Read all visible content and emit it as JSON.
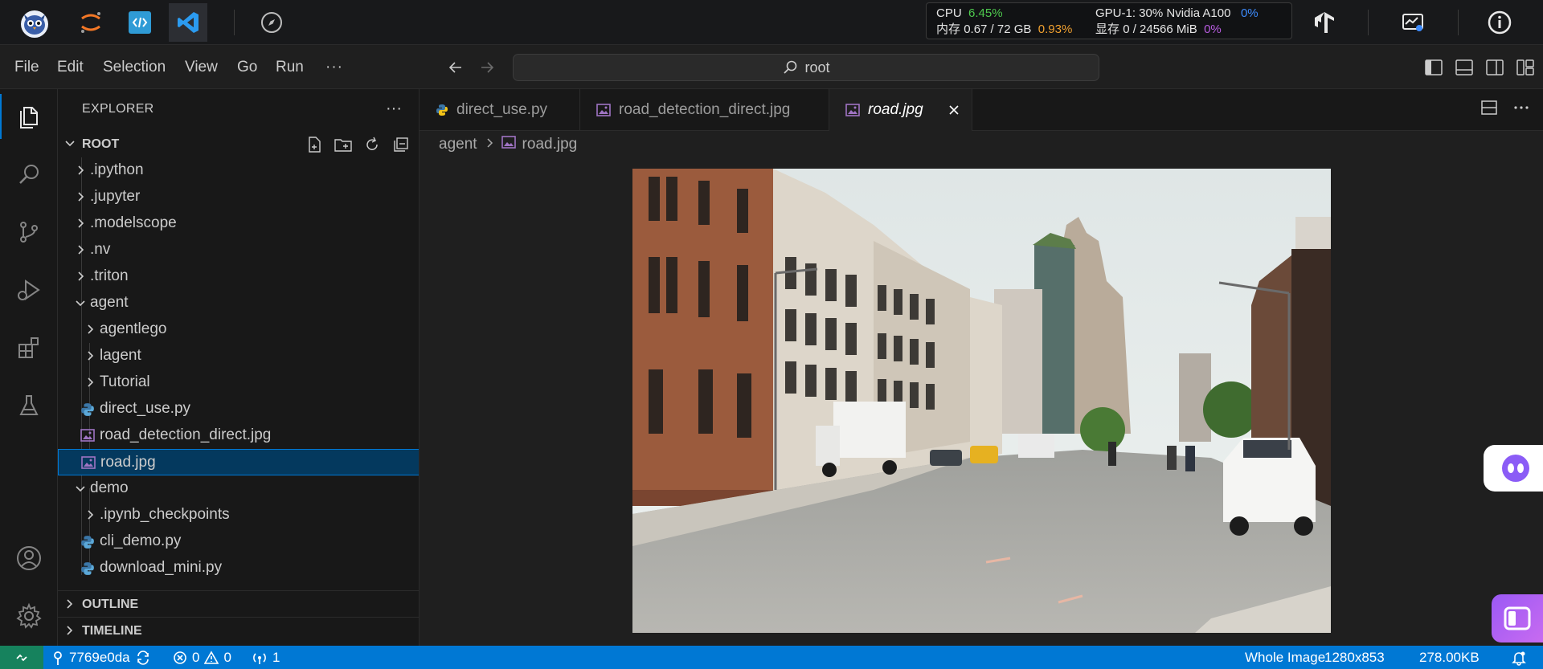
{
  "system_bar": {
    "cpu_label": "CPU",
    "cpu_value": "6.45%",
    "mem_label": "内存",
    "mem_value": "0.67 / 72 GB",
    "mem_percent": "0.93%",
    "gpu_label": "GPU-1: 30% Nvidia A100",
    "gpu_percent": "0%",
    "vram_label": "显存",
    "vram_value": "0 / 24566 MiB",
    "vram_percent": "0%"
  },
  "menu": {
    "items": [
      "File",
      "Edit",
      "Selection",
      "View",
      "Go",
      "Run",
      "···"
    ]
  },
  "command_center": {
    "text": "root"
  },
  "explorer": {
    "title": "EXPLORER",
    "more": "···",
    "root_label": "ROOT",
    "tree": [
      {
        "label": ".ipython",
        "type": "folder",
        "state": "collapsed",
        "depth": 1
      },
      {
        "label": ".jupyter",
        "type": "folder",
        "state": "collapsed",
        "depth": 1
      },
      {
        "label": ".modelscope",
        "type": "folder",
        "state": "collapsed",
        "depth": 1
      },
      {
        "label": ".nv",
        "type": "folder",
        "state": "collapsed",
        "depth": 1
      },
      {
        "label": ".triton",
        "type": "folder",
        "state": "collapsed",
        "depth": 1
      },
      {
        "label": "agent",
        "type": "folder",
        "state": "expanded",
        "depth": 1
      },
      {
        "label": "agentlego",
        "type": "folder",
        "state": "collapsed",
        "depth": 2
      },
      {
        "label": "lagent",
        "type": "folder",
        "state": "collapsed",
        "depth": 2
      },
      {
        "label": "Tutorial",
        "type": "folder",
        "state": "collapsed",
        "depth": 2
      },
      {
        "label": "direct_use.py",
        "type": "python",
        "depth": 2
      },
      {
        "label": "road_detection_direct.jpg",
        "type": "image",
        "depth": 2
      },
      {
        "label": "road.jpg",
        "type": "image",
        "depth": 2,
        "selected": true
      },
      {
        "label": "demo",
        "type": "folder",
        "state": "expanded",
        "depth": 1
      },
      {
        "label": ".ipynb_checkpoints",
        "type": "folder",
        "state": "collapsed",
        "depth": 2
      },
      {
        "label": "cli_demo.py",
        "type": "python",
        "depth": 2
      },
      {
        "label": "download_mini.py",
        "type": "python",
        "depth": 2
      }
    ],
    "outline_label": "OUTLINE",
    "timeline_label": "TIMELINE"
  },
  "tabs": [
    {
      "label": "direct_use.py",
      "type": "python",
      "active": false
    },
    {
      "label": "road_detection_direct.jpg",
      "type": "image",
      "active": false
    },
    {
      "label": "road.jpg",
      "type": "image",
      "active": true
    }
  ],
  "breadcrumb": {
    "folder": "agent",
    "file": "road.jpg"
  },
  "status_bar": {
    "branch": "7769e0da",
    "errors": "0",
    "warnings": "0",
    "ports": "1",
    "zoom": "Whole Image",
    "dimensions": "1280x853",
    "file_size": "278.00KB"
  },
  "colors": {
    "accent": "#0078d4",
    "status_bar": "#0078d4",
    "remote_indicator": "#16825d",
    "selection": "#04395e"
  }
}
